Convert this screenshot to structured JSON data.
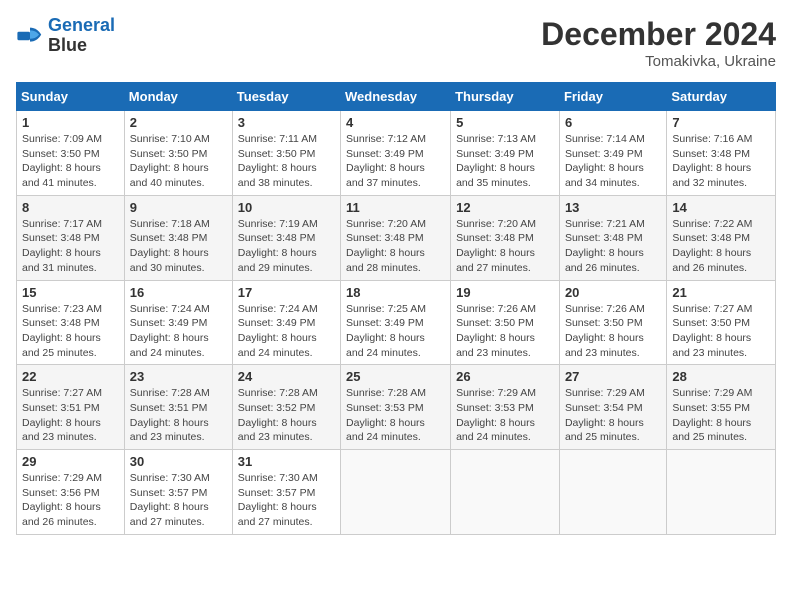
{
  "header": {
    "logo_line1": "General",
    "logo_line2": "Blue",
    "month_year": "December 2024",
    "location": "Tomakivka, Ukraine"
  },
  "columns": [
    "Sunday",
    "Monday",
    "Tuesday",
    "Wednesday",
    "Thursday",
    "Friday",
    "Saturday"
  ],
  "weeks": [
    [
      {
        "day": "1",
        "sunrise": "7:09 AM",
        "sunset": "3:50 PM",
        "daylight": "8 hours and 41 minutes."
      },
      {
        "day": "2",
        "sunrise": "7:10 AM",
        "sunset": "3:50 PM",
        "daylight": "8 hours and 40 minutes."
      },
      {
        "day": "3",
        "sunrise": "7:11 AM",
        "sunset": "3:50 PM",
        "daylight": "8 hours and 38 minutes."
      },
      {
        "day": "4",
        "sunrise": "7:12 AM",
        "sunset": "3:49 PM",
        "daylight": "8 hours and 37 minutes."
      },
      {
        "day": "5",
        "sunrise": "7:13 AM",
        "sunset": "3:49 PM",
        "daylight": "8 hours and 35 minutes."
      },
      {
        "day": "6",
        "sunrise": "7:14 AM",
        "sunset": "3:49 PM",
        "daylight": "8 hours and 34 minutes."
      },
      {
        "day": "7",
        "sunrise": "7:16 AM",
        "sunset": "3:48 PM",
        "daylight": "8 hours and 32 minutes."
      }
    ],
    [
      {
        "day": "8",
        "sunrise": "7:17 AM",
        "sunset": "3:48 PM",
        "daylight": "8 hours and 31 minutes."
      },
      {
        "day": "9",
        "sunrise": "7:18 AM",
        "sunset": "3:48 PM",
        "daylight": "8 hours and 30 minutes."
      },
      {
        "day": "10",
        "sunrise": "7:19 AM",
        "sunset": "3:48 PM",
        "daylight": "8 hours and 29 minutes."
      },
      {
        "day": "11",
        "sunrise": "7:20 AM",
        "sunset": "3:48 PM",
        "daylight": "8 hours and 28 minutes."
      },
      {
        "day": "12",
        "sunrise": "7:20 AM",
        "sunset": "3:48 PM",
        "daylight": "8 hours and 27 minutes."
      },
      {
        "day": "13",
        "sunrise": "7:21 AM",
        "sunset": "3:48 PM",
        "daylight": "8 hours and 26 minutes."
      },
      {
        "day": "14",
        "sunrise": "7:22 AM",
        "sunset": "3:48 PM",
        "daylight": "8 hours and 26 minutes."
      }
    ],
    [
      {
        "day": "15",
        "sunrise": "7:23 AM",
        "sunset": "3:48 PM",
        "daylight": "8 hours and 25 minutes."
      },
      {
        "day": "16",
        "sunrise": "7:24 AM",
        "sunset": "3:49 PM",
        "daylight": "8 hours and 24 minutes."
      },
      {
        "day": "17",
        "sunrise": "7:24 AM",
        "sunset": "3:49 PM",
        "daylight": "8 hours and 24 minutes."
      },
      {
        "day": "18",
        "sunrise": "7:25 AM",
        "sunset": "3:49 PM",
        "daylight": "8 hours and 24 minutes."
      },
      {
        "day": "19",
        "sunrise": "7:26 AM",
        "sunset": "3:50 PM",
        "daylight": "8 hours and 23 minutes."
      },
      {
        "day": "20",
        "sunrise": "7:26 AM",
        "sunset": "3:50 PM",
        "daylight": "8 hours and 23 minutes."
      },
      {
        "day": "21",
        "sunrise": "7:27 AM",
        "sunset": "3:50 PM",
        "daylight": "8 hours and 23 minutes."
      }
    ],
    [
      {
        "day": "22",
        "sunrise": "7:27 AM",
        "sunset": "3:51 PM",
        "daylight": "8 hours and 23 minutes."
      },
      {
        "day": "23",
        "sunrise": "7:28 AM",
        "sunset": "3:51 PM",
        "daylight": "8 hours and 23 minutes."
      },
      {
        "day": "24",
        "sunrise": "7:28 AM",
        "sunset": "3:52 PM",
        "daylight": "8 hours and 23 minutes."
      },
      {
        "day": "25",
        "sunrise": "7:28 AM",
        "sunset": "3:53 PM",
        "daylight": "8 hours and 24 minutes."
      },
      {
        "day": "26",
        "sunrise": "7:29 AM",
        "sunset": "3:53 PM",
        "daylight": "8 hours and 24 minutes."
      },
      {
        "day": "27",
        "sunrise": "7:29 AM",
        "sunset": "3:54 PM",
        "daylight": "8 hours and 25 minutes."
      },
      {
        "day": "28",
        "sunrise": "7:29 AM",
        "sunset": "3:55 PM",
        "daylight": "8 hours and 25 minutes."
      }
    ],
    [
      {
        "day": "29",
        "sunrise": "7:29 AM",
        "sunset": "3:56 PM",
        "daylight": "8 hours and 26 minutes."
      },
      {
        "day": "30",
        "sunrise": "7:30 AM",
        "sunset": "3:57 PM",
        "daylight": "8 hours and 27 minutes."
      },
      {
        "day": "31",
        "sunrise": "7:30 AM",
        "sunset": "3:57 PM",
        "daylight": "8 hours and 27 minutes."
      },
      null,
      null,
      null,
      null
    ]
  ],
  "labels": {
    "sunrise": "Sunrise:",
    "sunset": "Sunset:",
    "daylight": "Daylight:"
  }
}
